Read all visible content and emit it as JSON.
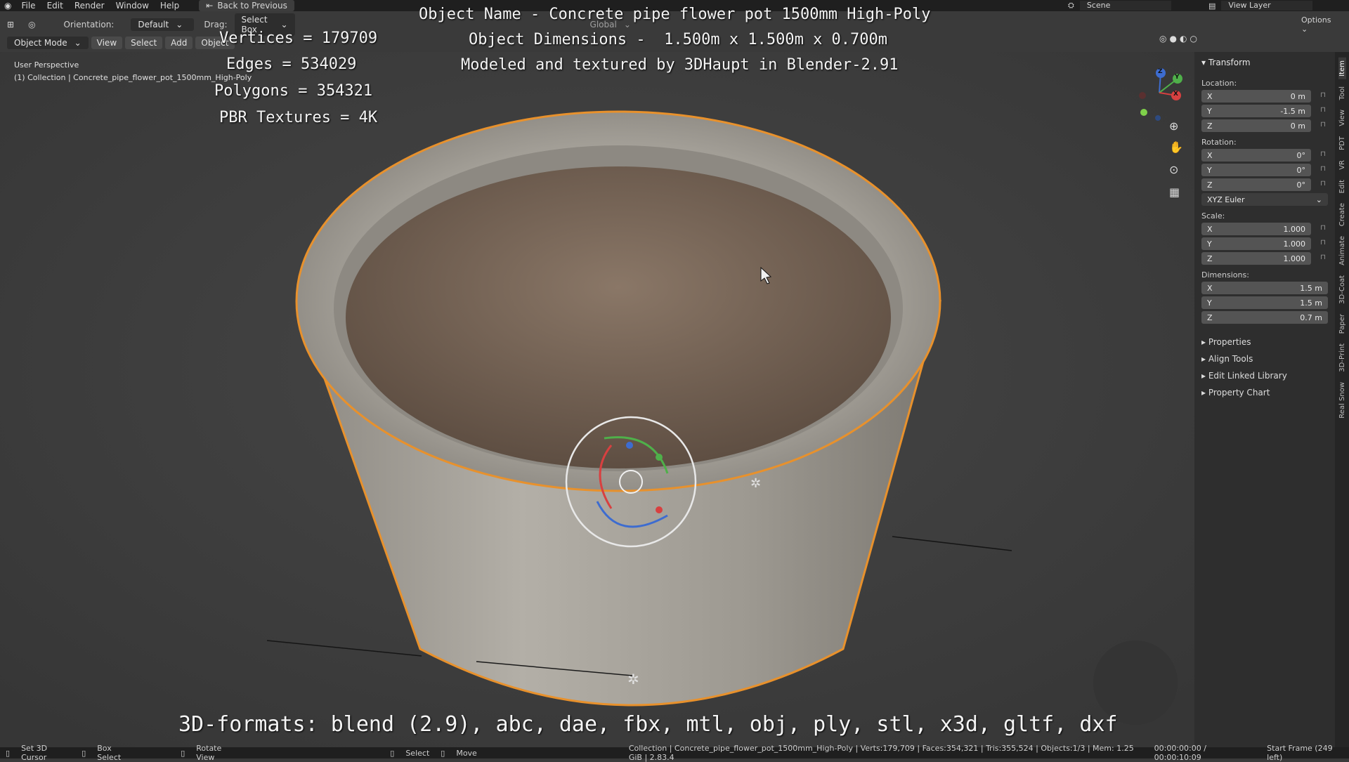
{
  "menu": {
    "items": [
      "File",
      "Edit",
      "Render",
      "Window",
      "Help"
    ],
    "back_button": "Back to Previous",
    "scene_label": "Scene",
    "view_layer_label": "View Layer"
  },
  "header": {
    "orientation_label": "Orientation:",
    "orientation_value": "Default",
    "drag_label": "Drag:",
    "drag_value": "Select Box",
    "transform_orientation": "Global",
    "options": "Options"
  },
  "header2": {
    "mode": "Object Mode",
    "view": "View",
    "select": "Select",
    "add": "Add",
    "object": "Object"
  },
  "viewport": {
    "perspective": "User Perspective",
    "collection": "(1) Collection | Concrete_pipe_flower_pot_1500mm_High-Poly"
  },
  "overlay": {
    "vertices": "Vertices = 179709",
    "edges": "Edges = 534029",
    "polygons": "Polygons = 354321",
    "textures": "PBR Textures = 4K",
    "name": "Object Name - Concrete pipe flower pot 1500mm High-Poly",
    "dimensions": "Object Dimensions -  1.500m x 1.500m x 0.700m",
    "credit": "Modeled and textured by 3DHaupt in Blender-2.91",
    "formats": "3D-formats: blend (2.9), abc, dae, fbx, mtl, obj, ply, stl, x3d, gltf, dxf"
  },
  "gizmo": {
    "x": "X",
    "y": "Y",
    "z": "Z"
  },
  "sidebar": {
    "transform_title": "Transform",
    "location_label": "Location:",
    "location": [
      {
        "axis": "X",
        "value": "0 m"
      },
      {
        "axis": "Y",
        "value": "-1.5 m"
      },
      {
        "axis": "Z",
        "value": "0 m"
      }
    ],
    "rotation_label": "Rotation:",
    "rotation": [
      {
        "axis": "X",
        "value": "0°"
      },
      {
        "axis": "Y",
        "value": "0°"
      },
      {
        "axis": "Z",
        "value": "0°"
      }
    ],
    "rotation_mode": "XYZ Euler",
    "scale_label": "Scale:",
    "scale": [
      {
        "axis": "X",
        "value": "1.000"
      },
      {
        "axis": "Y",
        "value": "1.000"
      },
      {
        "axis": "Z",
        "value": "1.000"
      }
    ],
    "dimensions_label": "Dimensions:",
    "dimensions": [
      {
        "axis": "X",
        "value": "1.5 m"
      },
      {
        "axis": "Y",
        "value": "1.5 m"
      },
      {
        "axis": "Z",
        "value": "0.7 m"
      }
    ],
    "panels": [
      "Properties",
      "Align Tools",
      "Edit Linked Library",
      "Property Chart"
    ]
  },
  "tabs": [
    "Item",
    "Tool",
    "View",
    "PDT",
    "VR",
    "Edit",
    "Create",
    "Animate",
    "3D-Coat",
    "Paper",
    "3D-Print",
    "Real Snow"
  ],
  "status": {
    "set_cursor": "Set 3D Cursor",
    "box_select": "Box Select",
    "rotate_view": "Rotate View",
    "select": "Select",
    "move": "Move",
    "stats": "Collection | Concrete_pipe_flower_pot_1500mm_High-Poly | Verts:179,709 | Faces:354,321 | Tris:355,524 | Objects:1/3 | Mem: 1.25 GiB | 2.83.4",
    "time": "00:00:00:00 / 00:00:10:09",
    "start_frame": "Start Frame (249 left)"
  },
  "colors": {
    "selection_outline": "#e8912c",
    "background": "#3a3a3a",
    "soil": "#7d6a5b",
    "concrete": "#a39f98"
  }
}
